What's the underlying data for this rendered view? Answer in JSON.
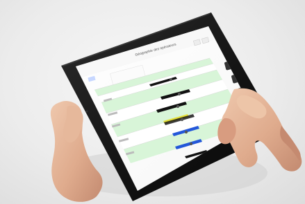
{
  "scene": {
    "subject": "tablet-held-in-hands",
    "screen": {
      "app_title": "Géographie des opérateurs",
      "colors": {
        "accent_green": "#d8f5d8",
        "black_bar": "#111111",
        "blue_bar": "#2357d9",
        "yellow_bar": "#e5df38"
      },
      "rows": [
        {
          "tone": "green"
        },
        {
          "tone": "white"
        },
        {
          "tone": "green"
        },
        {
          "tone": "white"
        },
        {
          "tone": "green"
        }
      ]
    }
  }
}
